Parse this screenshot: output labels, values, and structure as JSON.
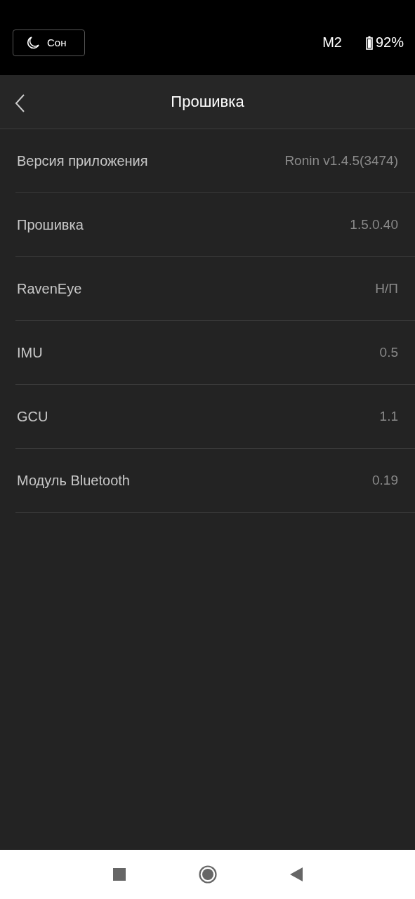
{
  "status_bar": {
    "sleep_button": "Сон",
    "mode": "M2",
    "battery": "92%"
  },
  "header": {
    "title": "Прошивка"
  },
  "rows": [
    {
      "label": "Версия приложения",
      "value": "Ronin v1.4.5(3474)"
    },
    {
      "label": "Прошивка",
      "value": "1.5.0.40"
    },
    {
      "label": "RavenEye",
      "value": "Н/П"
    },
    {
      "label": "IMU",
      "value": "0.5"
    },
    {
      "label": "GCU",
      "value": "1.1"
    },
    {
      "label": "Модуль Bluetooth",
      "value": "0.19"
    }
  ]
}
